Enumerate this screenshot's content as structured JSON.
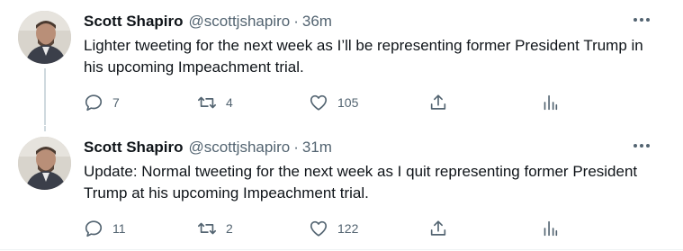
{
  "tweets": [
    {
      "author_name": "Scott Shapiro",
      "handle": "@scottjshapiro",
      "separator": "·",
      "time": "36m",
      "text": "Lighter tweeting for the next week as I’ll be representing former President Trump in his upcoming Impeachment trial.",
      "replies": "7",
      "retweets": "4",
      "likes": "105",
      "icons": [
        "avatar",
        "more-icon",
        "reply-icon",
        "retweet-icon",
        "like-icon",
        "share-icon",
        "analytics-icon"
      ]
    },
    {
      "author_name": "Scott Shapiro",
      "handle": "@scottjshapiro",
      "separator": "·",
      "time": "31m",
      "text": "Update: Normal tweeting for the next week as I quit representing former President Trump at his upcoming Impeachment trial.",
      "replies": "11",
      "retweets": "2",
      "likes": "122",
      "icons": [
        "avatar",
        "more-icon",
        "reply-icon",
        "retweet-icon",
        "like-icon",
        "share-icon",
        "analytics-icon"
      ]
    }
  ],
  "colors": {
    "text_primary": "#0f1419",
    "text_secondary": "#536471",
    "thread_line": "#cfd9de",
    "background": "#ffffff"
  }
}
